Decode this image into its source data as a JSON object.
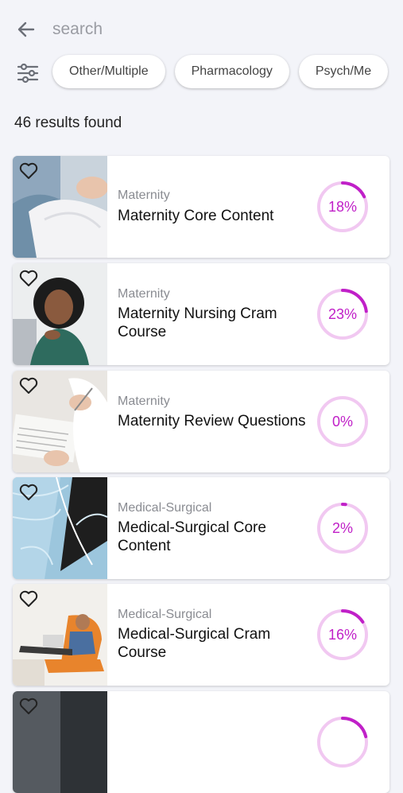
{
  "search": {
    "placeholder": "search",
    "value": ""
  },
  "filters": {
    "chips": [
      "Other/Multiple",
      "Pharmacology",
      "Psych/Me"
    ]
  },
  "results": {
    "count_text": "46 results found"
  },
  "colors": {
    "accent": "#c020c8",
    "ring_track": "#f1c8f1",
    "background": "#f3f4f9"
  },
  "courses": [
    {
      "category": "Maternity",
      "title": "Maternity Core Content",
      "percent_label": "18%",
      "progress": 0.18,
      "icon": "heart-icon"
    },
    {
      "category": "Maternity",
      "title": "Maternity Nursing Cram Course",
      "percent_label": "23%",
      "progress": 0.23,
      "icon": "heart-icon"
    },
    {
      "category": "Maternity",
      "title": "Maternity Review Questions",
      "percent_label": "0%",
      "progress": 0.0,
      "icon": "heart-icon"
    },
    {
      "category": "Medical-Surgical",
      "title": "Medical-Surgical Core Content",
      "percent_label": "2%",
      "progress": 0.02,
      "icon": "heart-icon"
    },
    {
      "category": "Medical-Surgical",
      "title": "Medical-Surgical Cram Course",
      "percent_label": "16%",
      "progress": 0.16,
      "icon": "heart-icon"
    }
  ],
  "icons": {
    "back": "arrow-left-icon",
    "filter": "sliders-icon",
    "favorite": "heart-icon"
  }
}
